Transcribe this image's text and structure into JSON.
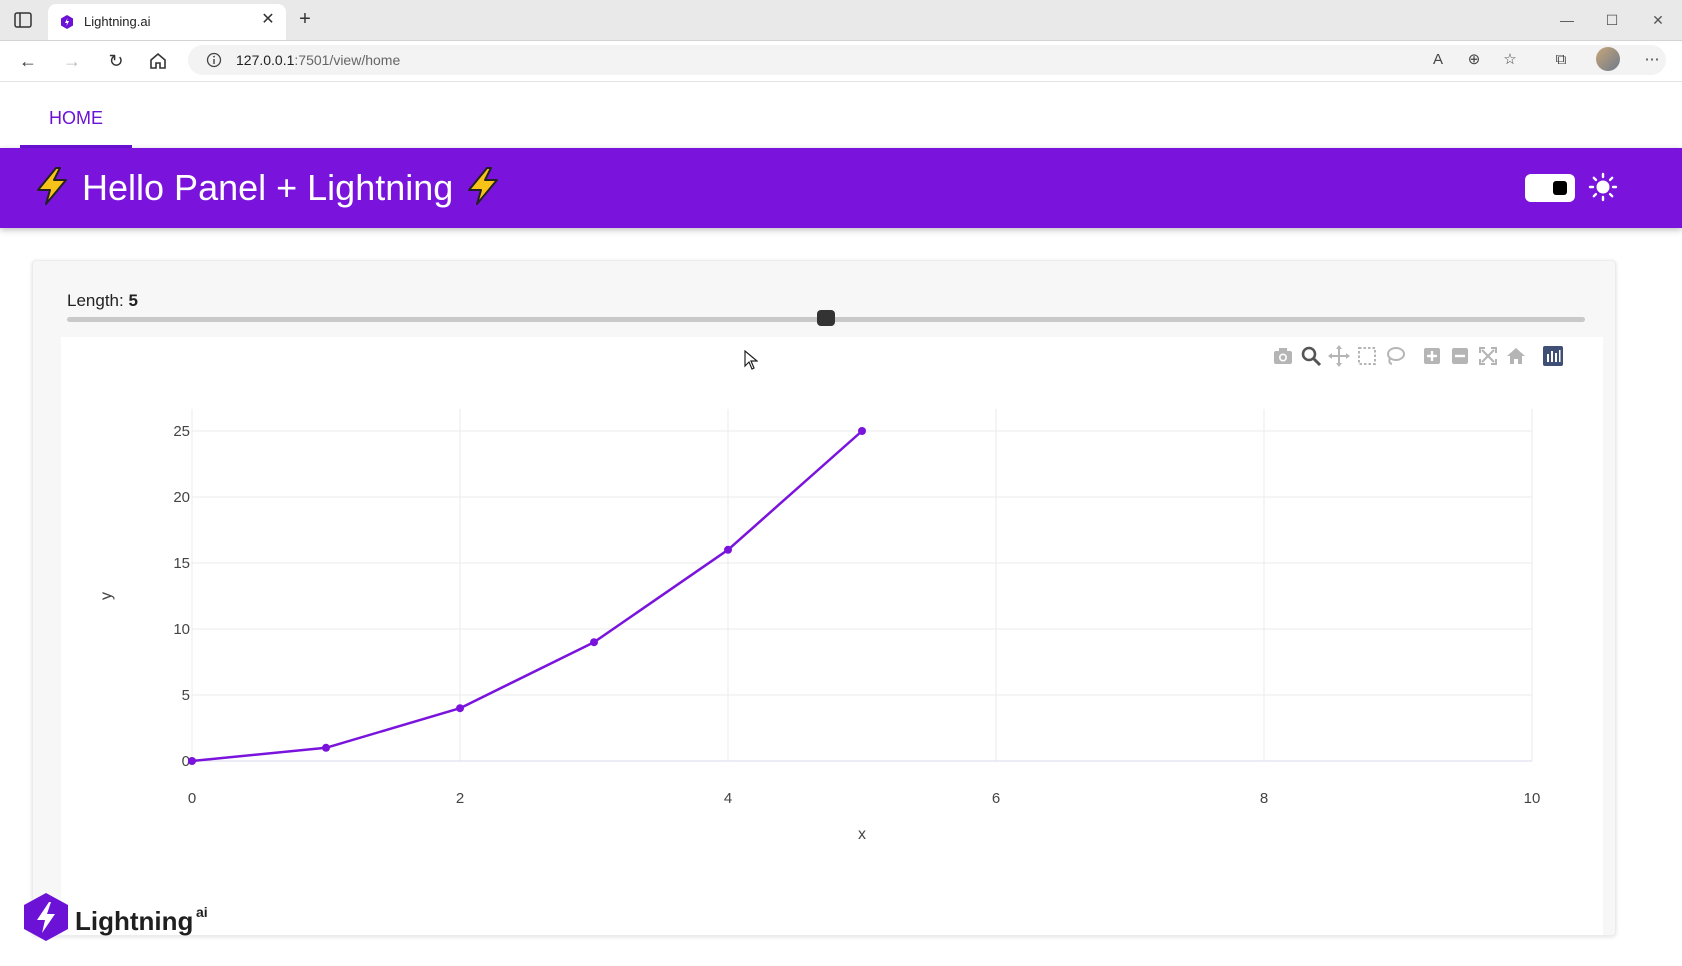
{
  "browser": {
    "tab_title": "Lightning.ai",
    "url_host": "127.0.0.1",
    "url_rest": ":7501/view/home"
  },
  "nav": {
    "home_label": "HOME"
  },
  "header": {
    "title": "Hello Panel + Lightning"
  },
  "slider": {
    "label": "Length: ",
    "value": "5",
    "min": 0,
    "max": 10,
    "current": 5
  },
  "logo": {
    "text": "Lightning",
    "sup": "ai"
  },
  "colors": {
    "accent": "#7a14dd",
    "line": "#7a14dd"
  },
  "chart_data": {
    "type": "line",
    "x": [
      0,
      1,
      2,
      3,
      4,
      5
    ],
    "y": [
      0,
      1,
      4,
      9,
      16,
      25
    ],
    "xlabel": "x",
    "ylabel": "y",
    "xlim": [
      0,
      10
    ],
    "ylim": [
      0,
      25
    ],
    "xticks": [
      0,
      2,
      4,
      6,
      8,
      10
    ],
    "yticks": [
      0,
      5,
      10,
      15,
      20,
      25
    ],
    "grid": true
  }
}
